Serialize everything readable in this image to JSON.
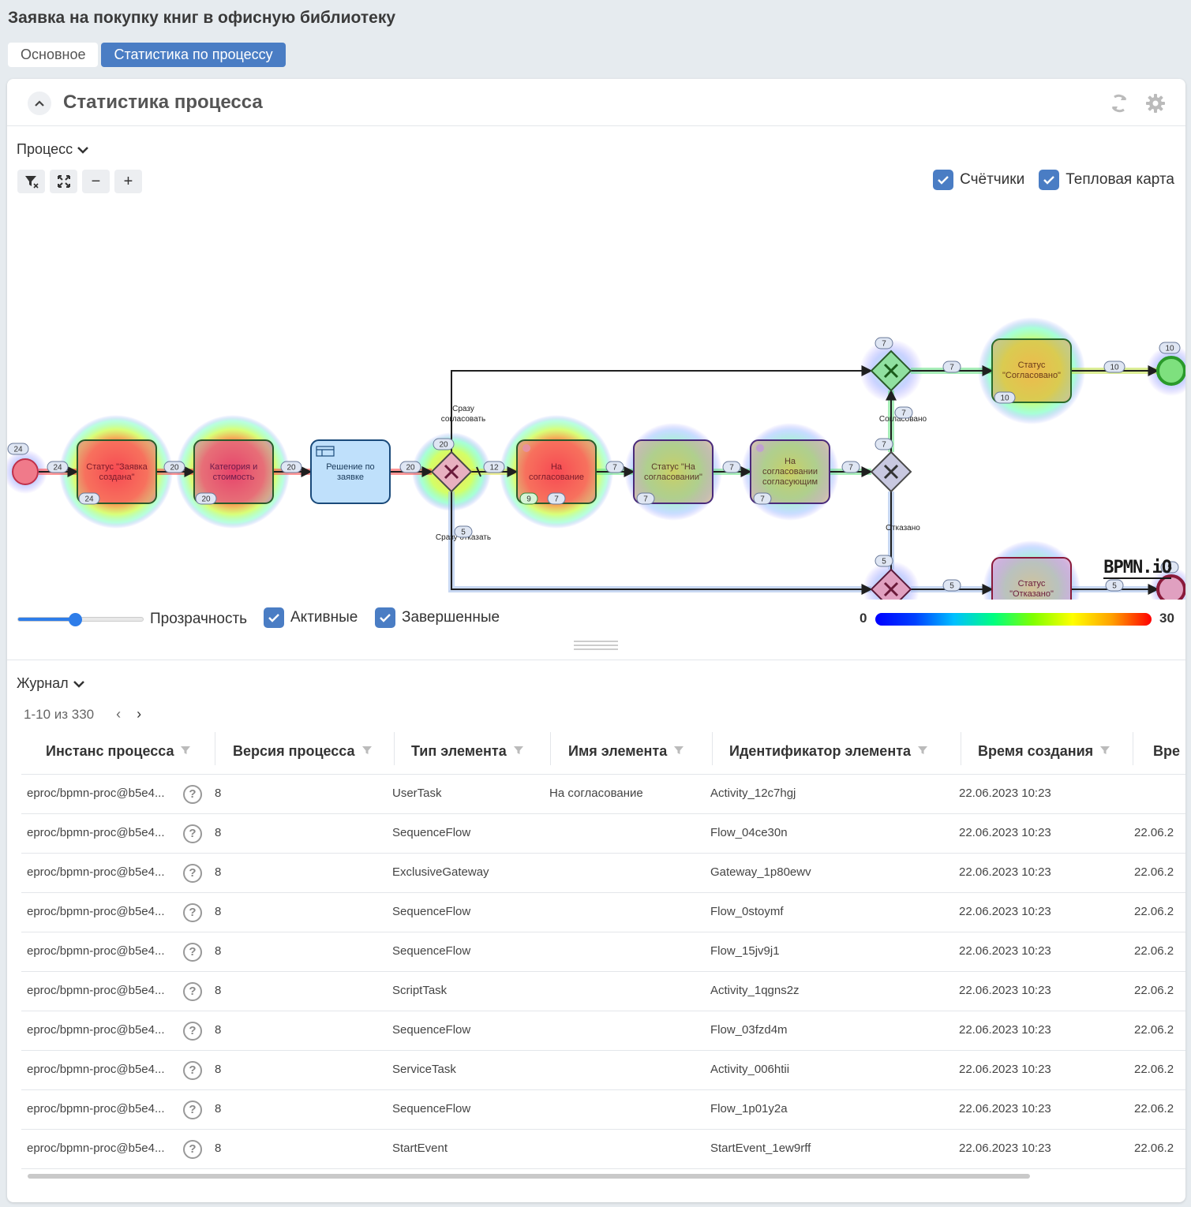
{
  "page": {
    "title": "Заявка на покупку книг в офисную библиотеку"
  },
  "tabs": [
    {
      "label": "Основное",
      "active": false
    },
    {
      "label": "Статистика по процессу",
      "active": true
    }
  ],
  "card": {
    "title": "Статистика процесса"
  },
  "process_section": {
    "title": "Процесс"
  },
  "checks": {
    "counters": "Счётчики",
    "heatmap": "Тепловая карта",
    "active": "Активные",
    "completed": "Завершенные"
  },
  "transparency": {
    "label": "Прозрачность",
    "value": 0.45
  },
  "legend": {
    "min": "0",
    "max": "30",
    "colors": [
      "#0000ff",
      "#00c0ff",
      "#00ff80",
      "#ffff00",
      "#ff0000"
    ]
  },
  "bpmn_logo": "BPMN.iO",
  "diagram": {
    "start_event": {
      "count": "24"
    },
    "tasks": {
      "t1": {
        "label": "Статус \"Заявка создана\"",
        "count": "24"
      },
      "t2": {
        "label": "Категория и стоимость",
        "count": "20"
      },
      "t3": {
        "label": "Решение по заявке"
      },
      "t4": {
        "label": "На согласование",
        "count_active": "9",
        "count": "7"
      },
      "t5": {
        "label": "Статус \"На согласовании\"",
        "count": "7"
      },
      "t6": {
        "label": "На согласовании согласующим",
        "count": "7"
      },
      "t7": {
        "label": "Статус \"Согласовано\"",
        "count": "10"
      },
      "t8": {
        "label": "Статус \"Отказано\"",
        "count": "5"
      }
    },
    "flows": {
      "f1": "24",
      "f2": "20",
      "f3": "20",
      "f4": "20",
      "f5": "12",
      "f6": "7",
      "f7": "7",
      "f8": "7",
      "f9": "7",
      "f10": "10",
      "f11": "5",
      "f12": "5",
      "g1": "20",
      "g2": "7",
      "g3": "7",
      "g4": "5",
      "upflow": "7",
      "downflow": "5",
      "end_ok": "10",
      "end_rej": "5"
    },
    "labels": {
      "approve_now_1": "Сразу",
      "approve_now_2": "согласовать",
      "reject_now": "Сразу отказать",
      "approved": "Согласовано",
      "rejected": "Отказано"
    }
  },
  "journal": {
    "title": "Журнал",
    "pager": "1-10 из 330",
    "columns": [
      "Инстанс процесса",
      "Версия процесса",
      "Тип элемента",
      "Имя элемента",
      "Идентификатор элемента",
      "Время создания",
      "Вре"
    ],
    "rows": [
      {
        "instance": "eproc/bpmn-proc@b5e4...",
        "version": "8",
        "type": "UserTask",
        "name": "На согласование",
        "id": "Activity_12c7hgj",
        "created": "22.06.2023 10:23",
        "extra": ""
      },
      {
        "instance": "eproc/bpmn-proc@b5e4...",
        "version": "8",
        "type": "SequenceFlow",
        "name": "",
        "id": "Flow_04ce30n",
        "created": "22.06.2023 10:23",
        "extra": "22.06.2"
      },
      {
        "instance": "eproc/bpmn-proc@b5e4...",
        "version": "8",
        "type": "ExclusiveGateway",
        "name": "",
        "id": "Gateway_1p80ewv",
        "created": "22.06.2023 10:23",
        "extra": "22.06.2"
      },
      {
        "instance": "eproc/bpmn-proc@b5e4...",
        "version": "8",
        "type": "SequenceFlow",
        "name": "",
        "id": "Flow_0stoymf",
        "created": "22.06.2023 10:23",
        "extra": "22.06.2"
      },
      {
        "instance": "eproc/bpmn-proc@b5e4...",
        "version": "8",
        "type": "SequenceFlow",
        "name": "",
        "id": "Flow_15jv9j1",
        "created": "22.06.2023 10:23",
        "extra": "22.06.2"
      },
      {
        "instance": "eproc/bpmn-proc@b5e4...",
        "version": "8",
        "type": "ScriptTask",
        "name": "",
        "id": "Activity_1qgns2z",
        "created": "22.06.2023 10:23",
        "extra": "22.06.2"
      },
      {
        "instance": "eproc/bpmn-proc@b5e4...",
        "version": "8",
        "type": "SequenceFlow",
        "name": "",
        "id": "Flow_03fzd4m",
        "created": "22.06.2023 10:23",
        "extra": "22.06.2"
      },
      {
        "instance": "eproc/bpmn-proc@b5e4...",
        "version": "8",
        "type": "ServiceTask",
        "name": "",
        "id": "Activity_006htii",
        "created": "22.06.2023 10:23",
        "extra": "22.06.2"
      },
      {
        "instance": "eproc/bpmn-proc@b5e4...",
        "version": "8",
        "type": "SequenceFlow",
        "name": "",
        "id": "Flow_1p01y2a",
        "created": "22.06.2023 10:23",
        "extra": "22.06.2"
      },
      {
        "instance": "eproc/bpmn-proc@b5e4...",
        "version": "8",
        "type": "StartEvent",
        "name": "",
        "id": "StartEvent_1ew9rff",
        "created": "22.06.2023 10:23",
        "extra": "22.06.2"
      }
    ]
  }
}
